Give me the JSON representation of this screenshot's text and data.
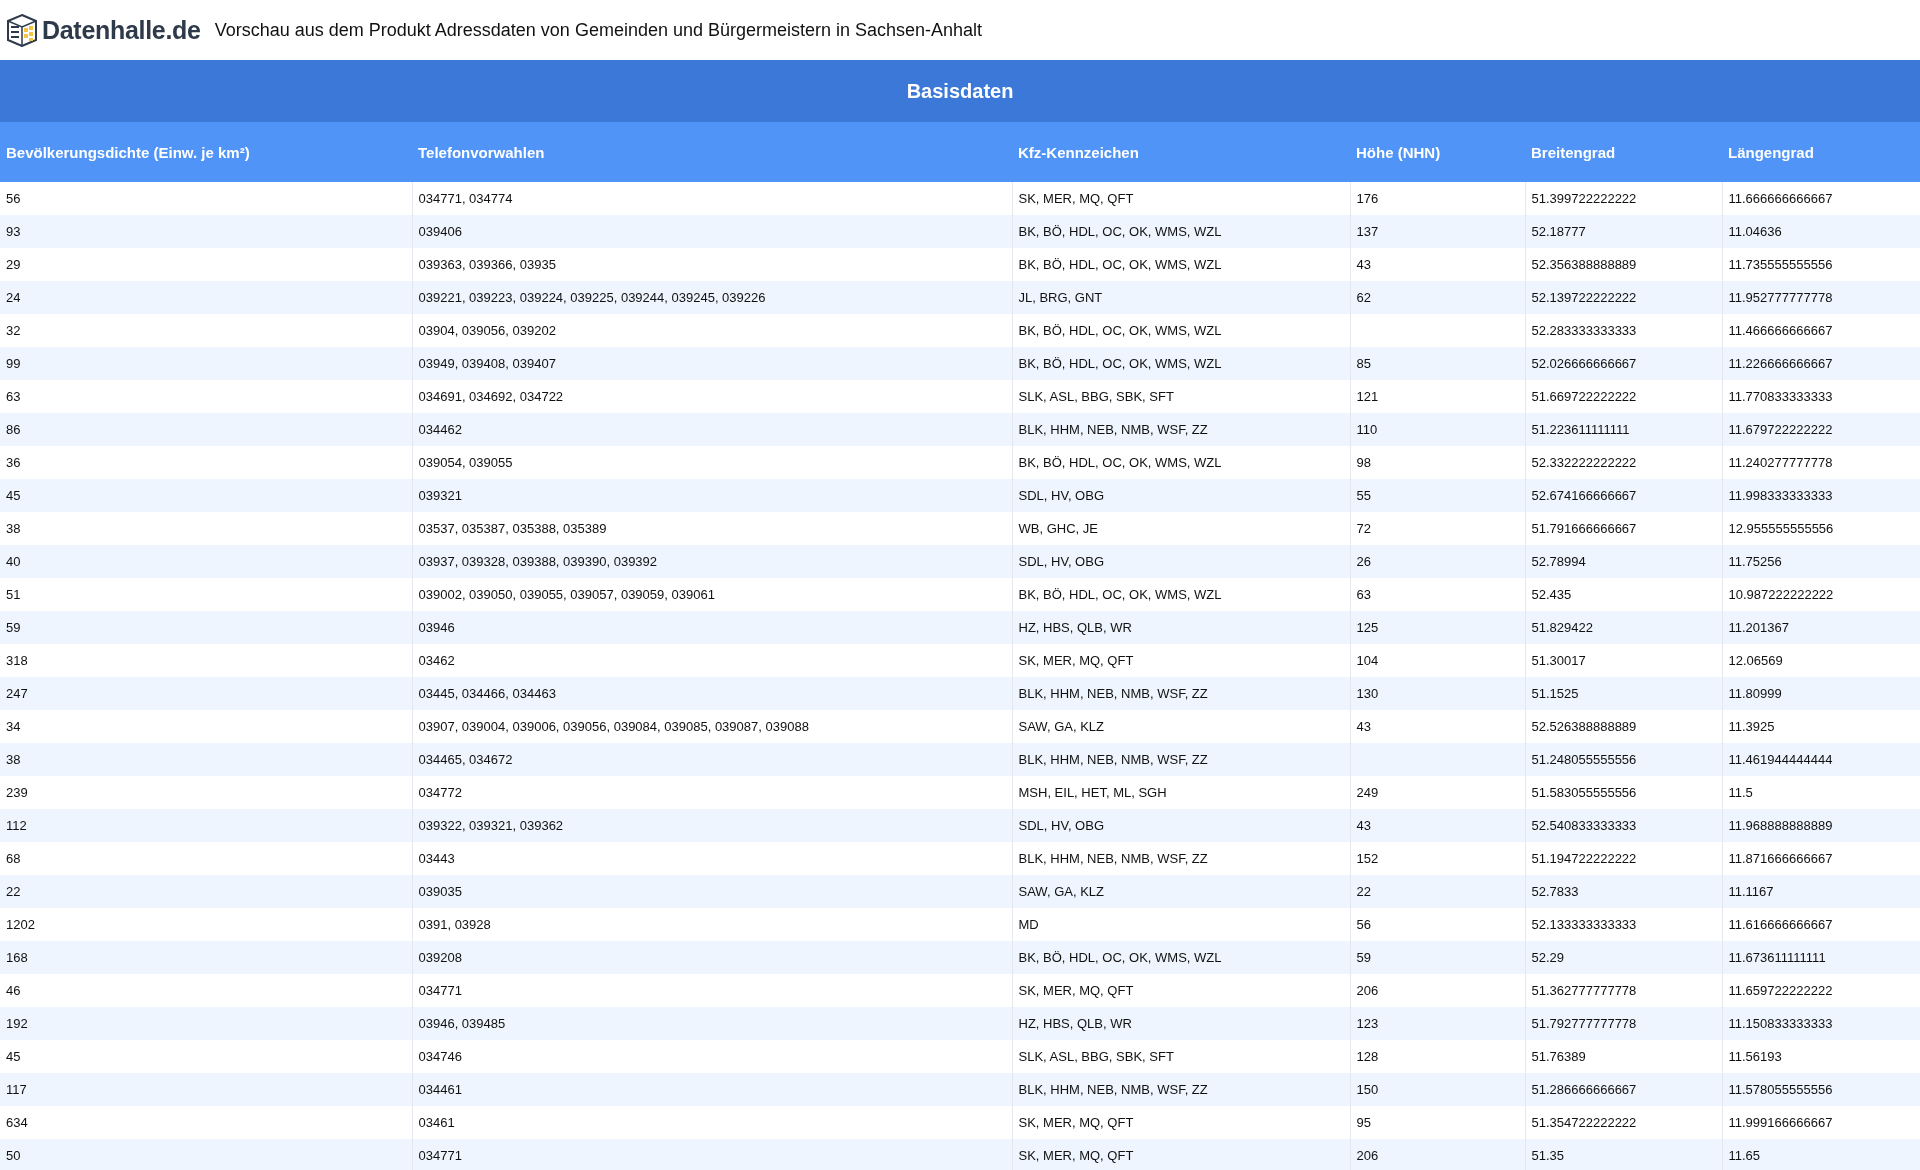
{
  "header": {
    "brand": "Datenhalle.de",
    "title": "Vorschau aus dem Produkt Adressdaten von Gemeinden und Bürgermeistern in Sachsen-Anhalt"
  },
  "table": {
    "group_title": "Basisdaten",
    "columns": [
      "Bevölkerungsdichte (Einw. je km²)",
      "Telefonvorwahlen",
      "Kfz-Kennzeichen",
      "Höhe (NHN)",
      "Breitengrad",
      "Längengrad"
    ],
    "rows": [
      [
        "56",
        "034771, 034774",
        "SK, MER, MQ, QFT",
        "176",
        "51.399722222222",
        "11.666666666667"
      ],
      [
        "93",
        "039406",
        "BK, BÖ, HDL, OC, OK, WMS, WZL",
        "137",
        "52.18777",
        "11.04636"
      ],
      [
        "29",
        "039363, 039366, 03935",
        "BK, BÖ, HDL, OC, OK, WMS, WZL",
        "43",
        "52.356388888889",
        "11.735555555556"
      ],
      [
        "24",
        "039221, 039223, 039224, 039225, 039244, 039245, 039226",
        "JL, BRG, GNT",
        "62",
        "52.139722222222",
        "11.952777777778"
      ],
      [
        "32",
        "03904, 039056, 039202",
        "BK, BÖ, HDL, OC, OK, WMS, WZL",
        null,
        "52.283333333333",
        "11.466666666667"
      ],
      [
        "99",
        "03949, 039408, 039407",
        "BK, BÖ, HDL, OC, OK, WMS, WZL",
        "85",
        "52.026666666667",
        "11.226666666667"
      ],
      [
        "63",
        "034691, 034692, 034722",
        "SLK, ASL, BBG, SBK, SFT",
        "121",
        "51.669722222222",
        "11.770833333333"
      ],
      [
        "86",
        "034462",
        "BLK, HHM, NEB, NMB, WSF, ZZ",
        "110",
        "51.223611111111",
        "11.679722222222"
      ],
      [
        "36",
        "039054, 039055",
        "BK, BÖ, HDL, OC, OK, WMS, WZL",
        "98",
        "52.332222222222",
        "11.240277777778"
      ],
      [
        "45",
        "039321",
        "SDL, HV, OBG",
        "55",
        "52.674166666667",
        "11.998333333333"
      ],
      [
        "38",
        "03537, 035387, 035388, 035389",
        "WB, GHC, JE",
        "72",
        "51.791666666667",
        "12.955555555556"
      ],
      [
        "40",
        "03937, 039328, 039388, 039390, 039392",
        "SDL, HV, OBG",
        "26",
        "52.78994",
        "11.75256"
      ],
      [
        "51",
        "039002, 039050, 039055, 039057, 039059, 039061",
        "BK, BÖ, HDL, OC, OK, WMS, WZL",
        "63",
        "52.435",
        "10.987222222222"
      ],
      [
        "59",
        "03946",
        "HZ, HBS, QLB, WR",
        "125",
        "51.829422",
        "11.201367"
      ],
      [
        "318",
        "03462",
        "SK, MER, MQ, QFT",
        "104",
        "51.30017",
        "12.06569"
      ],
      [
        "247",
        "03445, 034466, 034463",
        "BLK, HHM, NEB, NMB, WSF, ZZ",
        "130",
        "51.1525",
        "11.80999"
      ],
      [
        "34",
        "03907, 039004, 039006, 039056, 039084, 039085, 039087, 039088",
        "SAW, GA, KLZ",
        "43",
        "52.526388888889",
        "11.3925"
      ],
      [
        "38",
        "034465, 034672",
        "BLK, HHM, NEB, NMB, WSF, ZZ",
        null,
        "51.248055555556",
        "11.461944444444"
      ],
      [
        "239",
        "034772",
        "MSH, EIL, HET, ML, SGH",
        "249",
        "51.583055555556",
        "11.5"
      ],
      [
        "112",
        "039322, 039321, 039362",
        "SDL, HV, OBG",
        "43",
        "52.540833333333",
        "11.968888888889"
      ],
      [
        "68",
        "03443",
        "BLK, HHM, NEB, NMB, WSF, ZZ",
        "152",
        "51.194722222222",
        "11.871666666667"
      ],
      [
        "22",
        "039035",
        "SAW, GA, KLZ",
        "22",
        "52.7833",
        "11.1167"
      ],
      [
        "1202",
        "0391, 03928",
        "MD",
        "56",
        "52.133333333333",
        "11.616666666667"
      ],
      [
        "168",
        "039208",
        "BK, BÖ, HDL, OC, OK, WMS, WZL",
        "59",
        "52.29",
        "11.673611111111"
      ],
      [
        "46",
        "034771",
        "SK, MER, MQ, QFT",
        "206",
        "51.362777777778",
        "11.659722222222"
      ],
      [
        "192",
        "03946, 039485",
        "HZ, HBS, QLB, WR",
        "123",
        "51.792777777778",
        "11.150833333333"
      ],
      [
        "45",
        "034746",
        "SLK, ASL, BBG, SBK, SFT",
        "128",
        "51.76389",
        "11.56193"
      ],
      [
        "117",
        "034461",
        "BLK, HHM, NEB, NMB, WSF, ZZ",
        "150",
        "51.286666666667",
        "11.578055555556"
      ],
      [
        "634",
        "03461",
        "SK, MER, MQ, QFT",
        "95",
        "51.354722222222",
        "11.999166666667"
      ],
      [
        "50",
        "034771",
        "SK, MER, MQ, QFT",
        "206",
        "51.35",
        "11.65"
      ]
    ]
  }
}
